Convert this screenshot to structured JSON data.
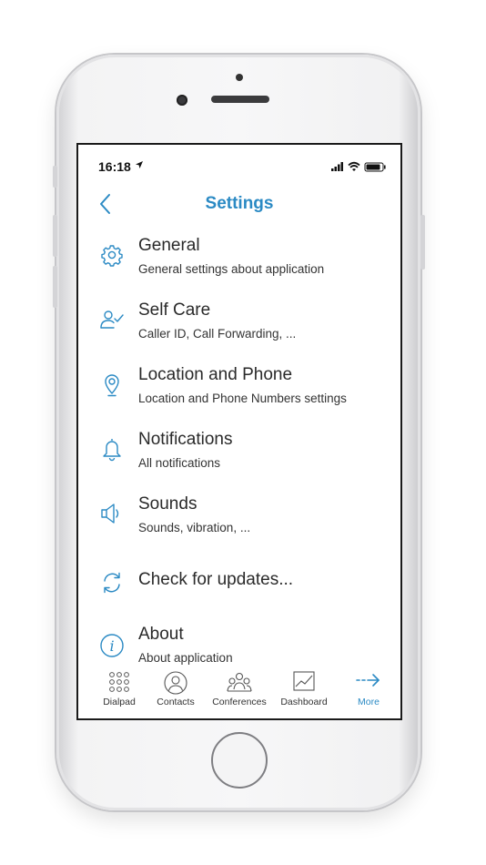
{
  "status_bar": {
    "time": "16:18"
  },
  "nav": {
    "title": "Settings"
  },
  "settings_items": [
    {
      "title": "General",
      "subtitle": "General settings about application",
      "icon": "gear-icon"
    },
    {
      "title": "Self Care",
      "subtitle": "Caller ID, Call Forwarding, ...",
      "icon": "user-check-icon"
    },
    {
      "title": "Location and Phone",
      "subtitle": "Location and Phone Numbers settings",
      "icon": "location-pin-icon"
    },
    {
      "title": "Notifications",
      "subtitle": "All notifications",
      "icon": "bell-icon"
    },
    {
      "title": "Sounds",
      "subtitle": "Sounds, vibration, ...",
      "icon": "speaker-icon"
    },
    {
      "title": "Check for updates...",
      "subtitle": "",
      "icon": "refresh-icon"
    },
    {
      "title": "About",
      "subtitle": "About application",
      "icon": "info-icon"
    }
  ],
  "tabs": [
    {
      "label": "Dialpad",
      "icon": "dialpad-icon"
    },
    {
      "label": "Contacts",
      "icon": "contacts-icon"
    },
    {
      "label": "Conferences",
      "icon": "conferences-icon"
    },
    {
      "label": "Dashboard",
      "icon": "dashboard-icon"
    },
    {
      "label": "More",
      "icon": "more-arrow-icon",
      "active": true
    }
  ],
  "colors": {
    "accent": "#2b8ac4",
    "text": "#2a2a2a"
  }
}
